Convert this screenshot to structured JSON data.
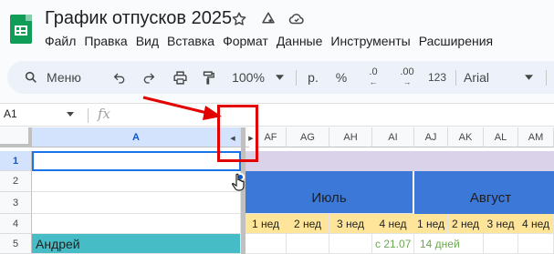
{
  "doc": {
    "title": "График отпусков 2025"
  },
  "menu": [
    "Файл",
    "Правка",
    "Вид",
    "Вставка",
    "Формат",
    "Данные",
    "Инструменты",
    "Расширения"
  ],
  "toolbar": {
    "search_label": "Меню",
    "zoom": "100%",
    "currency": "р.",
    "percent": "%",
    "dec_decrease": ".0",
    "dec_increase": ".00",
    "number_format": "123",
    "font": "Arial"
  },
  "formula_bar": {
    "cell_ref": "A1",
    "fx": "fx"
  },
  "columns": {
    "frozen": "A",
    "scroll": [
      "AF",
      "AG",
      "AH",
      "AI",
      "AJ",
      "AK",
      "AL",
      "AM"
    ]
  },
  "rows": [
    "1",
    "2",
    "3",
    "4",
    "5"
  ],
  "cells": {
    "month_july": "Июль",
    "month_august": "Август",
    "weeks": [
      "1 нед",
      "2 нед",
      "3 нед",
      "4 нед",
      "1 нед",
      "2 нед",
      "3 нед",
      "4 нед"
    ],
    "employee": "Андрей",
    "vacation_start": "с 21.07",
    "vacation_days": "14 дней"
  },
  "colors": {
    "header_blue": "#3c78d8",
    "week_yellow": "#ffe599",
    "name_teal": "#46bdc6",
    "lavender": "#d9d2e9",
    "vacation_green": "#6aa84f",
    "annotation_red": "#e30000"
  }
}
